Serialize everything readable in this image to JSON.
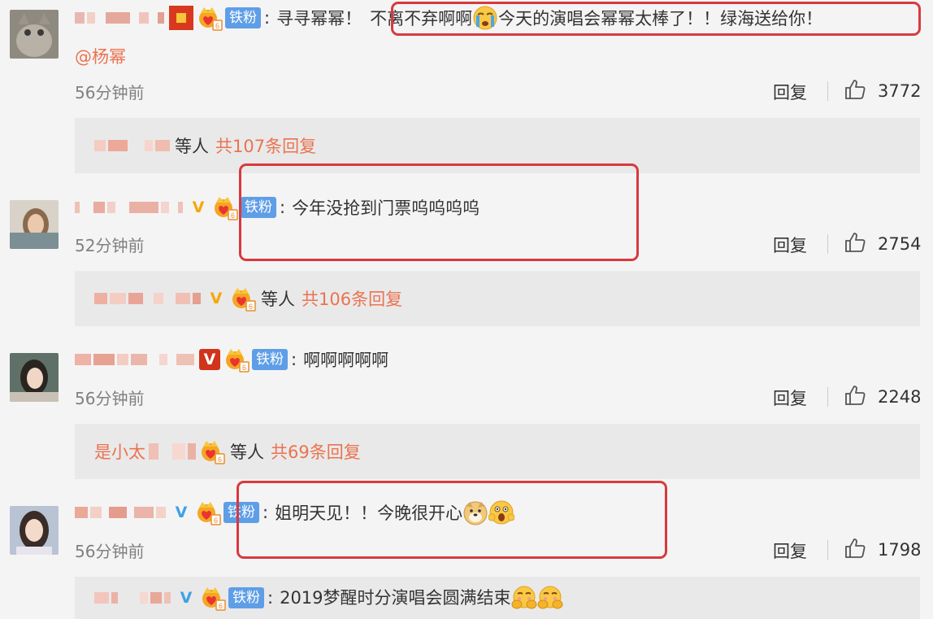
{
  "comments": [
    {
      "fan_label": "铁粉",
      "text_pre": "寻寻幂幂！",
      "text_highlight_a": "不离不弃啊啊",
      "text_highlight_b": "今天的演唱会幂幂太棒了！！绿海送给你！",
      "mention": "@杨幂",
      "time": "56分钟前",
      "reply_label": "回复",
      "likes": "3772"
    },
    {
      "fan_label": "铁粉",
      "text": "今年没抢到门票呜呜呜呜",
      "time": "52分钟前",
      "reply_label": "回复",
      "likes": "2754"
    },
    {
      "fan_label": "铁粉",
      "text": "啊啊啊啊啊",
      "time": "56分钟前",
      "reply_label": "回复",
      "likes": "2248"
    },
    {
      "fan_label": "铁粉",
      "text": "姐明天见！！今晚很开心",
      "time": "56分钟前",
      "reply_label": "回复",
      "likes": "1798"
    }
  ],
  "reply_bars": [
    {
      "etc": "等人",
      "total": "共107条回复"
    },
    {
      "etc": "等人",
      "total": "共106条回复"
    },
    {
      "prefix": "是小太",
      "etc": "等人",
      "total": "共69条回复"
    }
  ],
  "reply_preview": {
    "fan_label": "铁粉",
    "text": "2019梦醒时分演唱会圆满结束"
  },
  "colors": {
    "accent_orange": "#eb7350",
    "fan_tag_blue": "#5e9ee7",
    "highlight_red": "#d9393e",
    "vip_gold": "#f6a70a"
  }
}
